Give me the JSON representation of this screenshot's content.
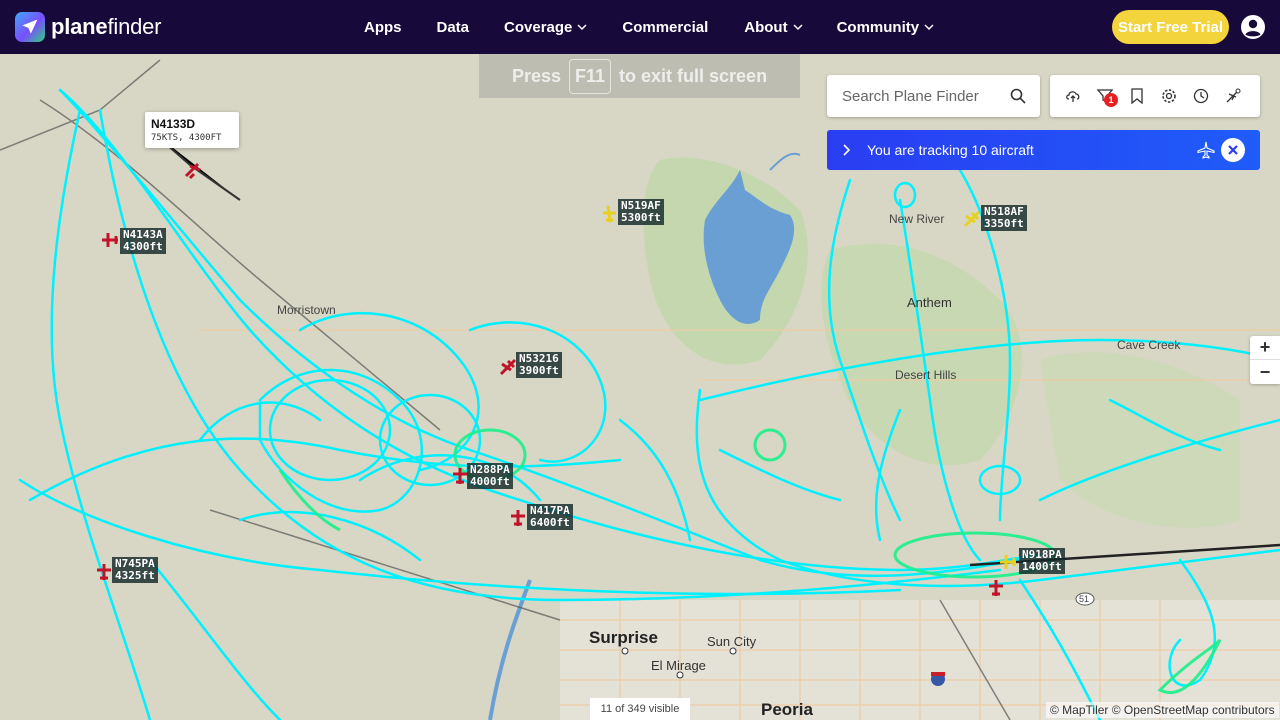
{
  "header": {
    "logo_text_bold": "plane",
    "logo_text": "finder",
    "nav": [
      "Apps",
      "Data",
      "Coverage",
      "Commercial",
      "About",
      "Community"
    ],
    "cta_label": "Start Free Trial"
  },
  "fullscreen_hint": {
    "before": "Press",
    "key": "F11",
    "after": "to exit full screen"
  },
  "search": {
    "placeholder": "Search Plane Finder"
  },
  "toolbar": {
    "icons": [
      "cloud-upload-icon",
      "filter-icon",
      "bookmark-icon",
      "gear-icon",
      "history-icon",
      "plane-cog-icon"
    ],
    "filter_badge": "1"
  },
  "tracking": {
    "text": "You are tracking 10 aircraft"
  },
  "popup": {
    "callsign": "N4133D",
    "info": "75KTS, 4300FT"
  },
  "aircraft": [
    {
      "callsign": "N4143A",
      "alt": "4300ft",
      "color": "#c0142a"
    },
    {
      "callsign": "N519AF",
      "alt": "5300ft",
      "color": "#e8d020"
    },
    {
      "callsign": "N518AF",
      "alt": "3350ft",
      "color": "#e8d020"
    },
    {
      "callsign": "N53216",
      "alt": "3900ft",
      "color": "#c0142a"
    },
    {
      "callsign": "N288PA",
      "alt": "4000ft",
      "color": "#c0142a"
    },
    {
      "callsign": "N417PA",
      "alt": "6400ft",
      "color": "#c0142a"
    },
    {
      "callsign": "N745PA",
      "alt": "4325ft",
      "color": "#c0142a"
    },
    {
      "callsign": "N918PA",
      "alt": "1400ft",
      "color": "#e8d020"
    }
  ],
  "places": [
    "New River",
    "Anthem",
    "Cave Creek",
    "Desert Hills",
    "Surprise",
    "Sun City",
    "El Mirage",
    "Peoria",
    "Morristown",
    "51"
  ],
  "zoom": {
    "in": "+",
    "out": "−"
  },
  "visible_count": "11 of 349 visible",
  "attribution": "© MapTiler © OpenStreetMap contributors",
  "colors": {
    "header_bg": "#17093a",
    "cta": "#f3d43c",
    "track": "#00f0ff",
    "track_low": "#19f08a",
    "tracking_bar": "#2a3df2"
  }
}
